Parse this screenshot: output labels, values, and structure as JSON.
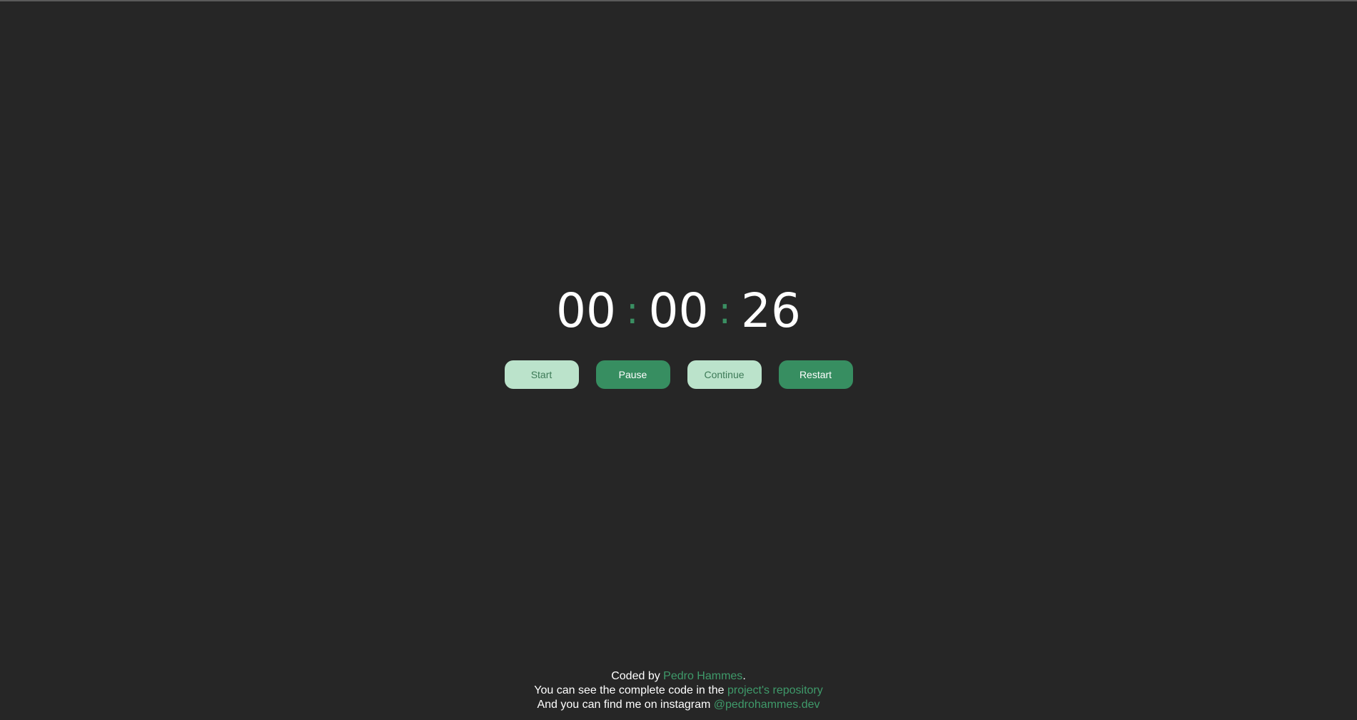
{
  "timer": {
    "hours": "00",
    "minutes": "00",
    "seconds": "26",
    "separator": ":"
  },
  "controls": {
    "start_label": "Start",
    "pause_label": "Pause",
    "continue_label": "Continue",
    "restart_label": "Restart"
  },
  "footer": {
    "line1_prefix": "Coded by ",
    "author_link": "Pedro Hammes",
    "line1_suffix": ".",
    "line2_prefix": "You can see the complete code in the ",
    "repo_link": "project's repository",
    "line3_prefix": "And you can find me on instagram ",
    "instagram_link": "@pedrohammes.dev"
  },
  "colors": {
    "background": "#262626",
    "accent": "#378e61",
    "light_button": "#bbe3cb",
    "link": "#3f9a6a"
  }
}
